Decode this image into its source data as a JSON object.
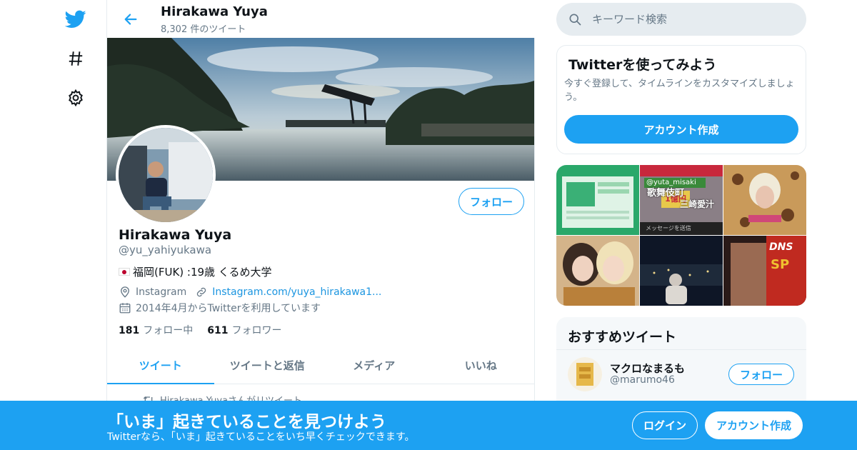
{
  "nav": {
    "icons": [
      "twitter-bird-icon",
      "hashtag-icon",
      "gear-icon"
    ]
  },
  "header": {
    "title": "Hirakawa Yuya",
    "tweet_count": "8,302 件のツイート"
  },
  "profile": {
    "name": "Hirakawa Yuya",
    "handle": "@yu_yahiyukawa",
    "bio": "福岡(FUK) :19歳 くるめ大学",
    "location": "Instagram",
    "url": "Instagram.com/yuya_hirakawa1...",
    "joined": "2014年4月からTwitterを利用しています",
    "following_count": "181",
    "following_label": "フォロー中",
    "followers_count": "611",
    "followers_label": "フォロワー",
    "follow_label": "フォロー"
  },
  "tabs": [
    {
      "label": "ツイート"
    },
    {
      "label": "ツイートと返信"
    },
    {
      "label": "メディア"
    },
    {
      "label": "いいね"
    }
  ],
  "retweet_note": "Hirakawa Yuyaさんがリツイート",
  "search": {
    "placeholder": "キーワード検索"
  },
  "signup_card": {
    "title": "Twitterを使ってみよう",
    "body": "今すぐ登録して、タイムラインをカスタマイズしましょう。",
    "button": "アカウント作成"
  },
  "media": {
    "tile_texts": {
      "mention": "@yuta_misaki",
      "kabuki": "歌舞伎町",
      "misaki": "三崎愛汁",
      "message": "メッセージを送信",
      "money": "1億円",
      "brand": "DNS",
      "product": "SP"
    }
  },
  "recommend": {
    "title": "おすすめツイート",
    "name": "マクロなまるも",
    "handle": "@marumo46",
    "follow_label": "フォロー"
  },
  "bottom_bar": {
    "title": "「いま」起きていることを見つけよう",
    "subtitle": "Twitterなら、「いま」起きていることをいち早くチェックできます。",
    "login": "ログイン",
    "signup": "アカウント作成"
  },
  "colors": {
    "accent": "#1da1f2",
    "text_secondary": "#657786",
    "border": "#e6ecf0"
  }
}
